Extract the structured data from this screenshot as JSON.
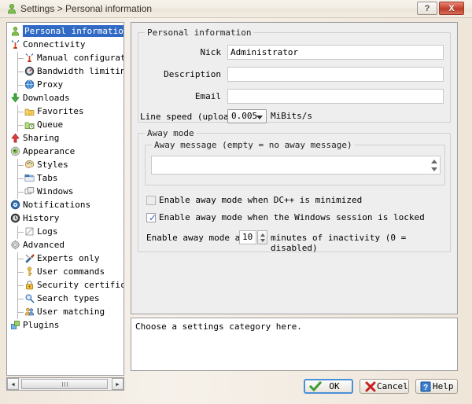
{
  "window": {
    "title": "Settings > Personal information",
    "icon": "user-icon",
    "help_button": "?",
    "close_button": "X"
  },
  "sidebar": {
    "items": [
      {
        "label": "Personal information",
        "level": 0,
        "icon": "user-icon",
        "selected": true
      },
      {
        "label": "Connectivity",
        "level": 0,
        "icon": "antenna-icon",
        "selected": false
      },
      {
        "label": "Manual configuration",
        "level": 1,
        "icon": "antenna-small-icon",
        "selected": false
      },
      {
        "label": "Bandwidth limiting",
        "level": 1,
        "icon": "gauge-icon",
        "selected": false
      },
      {
        "label": "Proxy",
        "level": 1,
        "icon": "globe-icon",
        "selected": false
      },
      {
        "label": "Downloads",
        "level": 0,
        "icon": "download-arrow-icon",
        "selected": false
      },
      {
        "label": "Favorites",
        "level": 1,
        "icon": "star-folder-icon",
        "selected": false
      },
      {
        "label": "Queue",
        "level": 1,
        "icon": "clock-folder-icon",
        "selected": false
      },
      {
        "label": "Sharing",
        "level": 0,
        "icon": "upload-arrow-icon",
        "selected": false
      },
      {
        "label": "Appearance",
        "level": 0,
        "icon": "appearance-icon",
        "selected": false
      },
      {
        "label": "Styles",
        "level": 1,
        "icon": "palette-icon",
        "selected": false
      },
      {
        "label": "Tabs",
        "level": 1,
        "icon": "tabs-icon",
        "selected": false
      },
      {
        "label": "Windows",
        "level": 1,
        "icon": "windows-icon",
        "selected": false
      },
      {
        "label": "Notifications",
        "level": 0,
        "icon": "notification-icon",
        "selected": false
      },
      {
        "label": "History",
        "level": 0,
        "icon": "history-icon",
        "selected": false
      },
      {
        "label": "Logs",
        "level": 1,
        "icon": "log-icon",
        "selected": false
      },
      {
        "label": "Advanced",
        "level": 0,
        "icon": "gear-icon",
        "selected": false
      },
      {
        "label": "Experts only",
        "level": 1,
        "icon": "tools-icon",
        "selected": false
      },
      {
        "label": "User commands",
        "level": 1,
        "icon": "key-icon",
        "selected": false
      },
      {
        "label": "Security certificates",
        "level": 1,
        "icon": "lock-icon",
        "selected": false
      },
      {
        "label": "Search types",
        "level": 1,
        "icon": "magnifier-icon",
        "selected": false
      },
      {
        "label": "User matching",
        "level": 1,
        "icon": "users-icon",
        "selected": false
      },
      {
        "label": "Plugins",
        "level": 0,
        "icon": "plugin-icon",
        "selected": false
      }
    ],
    "scrollbar": {
      "left_arrow": "◀",
      "right_arrow": "▶"
    }
  },
  "main": {
    "personal_group": {
      "legend": "Personal information",
      "nick_label": "Nick",
      "nick_value": "Administrator",
      "description_label": "Description",
      "description_value": "",
      "email_label": "Email",
      "email_value": "",
      "line_speed_label": "Line speed (upload)",
      "line_speed_value": "0.005",
      "line_speed_unit": "MiBits/s"
    },
    "away_group": {
      "legend": "Away mode",
      "away_message_legend": "Away message (empty = no away message)",
      "away_message_value": "",
      "checkbox_minimized": {
        "label": "Enable away mode when DC++ is minimized",
        "checked": false
      },
      "checkbox_locked": {
        "label": "Enable away mode when the Windows session is locked",
        "checked": true,
        "check_glyph": "✓"
      },
      "inactivity_prefix": "Enable away mode after",
      "inactivity_value": "10",
      "inactivity_suffix": "minutes of inactivity (0 = disabled)"
    }
  },
  "status": {
    "text": "Choose a settings category here."
  },
  "buttons": {
    "ok": {
      "label": "OK",
      "icon": "check-icon"
    },
    "cancel": {
      "label": "Cancel",
      "icon": "x-icon"
    },
    "help": {
      "label": "Help",
      "icon": "question-icon"
    }
  },
  "colors": {
    "selection_blue": "#316ac5",
    "close_red": "#c94a35",
    "check_blue": "#2b5fd9",
    "ok_check_green": "#3c9c2e",
    "cancel_red": "#c92020",
    "focus_border": "#4a90d9"
  }
}
